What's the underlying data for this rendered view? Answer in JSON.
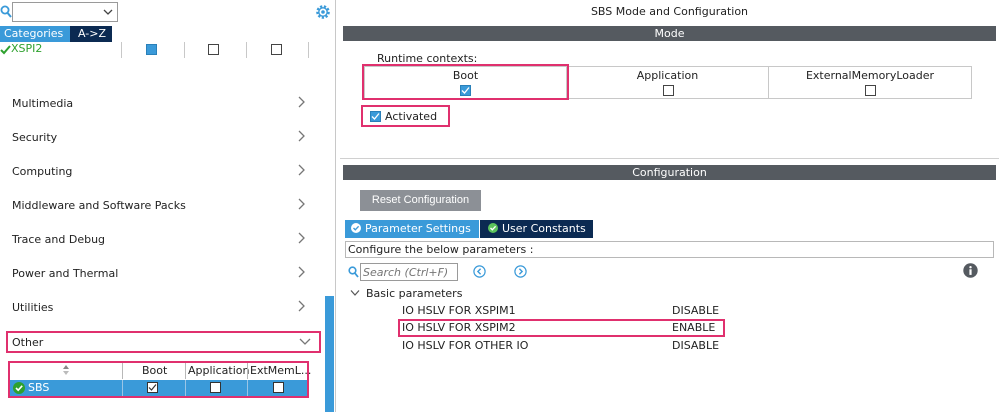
{
  "left": {
    "search": {
      "value": ""
    },
    "tabs": [
      {
        "label": "Categories"
      },
      {
        "label": "A->Z"
      }
    ],
    "xspi_row": {
      "name": "XSPI2"
    },
    "categories": [
      {
        "label": "Multimedia"
      },
      {
        "label": "Security"
      },
      {
        "label": "Computing"
      },
      {
        "label": "Middleware and Software Packs"
      },
      {
        "label": "Trace and Debug"
      },
      {
        "label": "Power and Thermal"
      },
      {
        "label": "Utilities"
      }
    ],
    "other": {
      "label": "Other"
    },
    "sbs_table": {
      "headers": [
        "Boot",
        "Application",
        "ExtMemL..."
      ],
      "row": {
        "name": "SBS",
        "boot": true,
        "application": false,
        "extmem": false
      }
    }
  },
  "right": {
    "title": "SBS Mode and Configuration",
    "mode_bar": "Mode",
    "runtime_label": "Runtime contexts:",
    "contexts": [
      {
        "label": "Boot",
        "checked": true
      },
      {
        "label": "Application",
        "checked": false
      },
      {
        "label": "ExternalMemoryLoader",
        "checked": false
      }
    ],
    "activated": {
      "label": "Activated",
      "checked": true
    },
    "config_bar": "Configuration",
    "reset_button": "Reset Configuration",
    "param_tabs": [
      {
        "label": "Parameter Settings"
      },
      {
        "label": "User Constants"
      }
    ],
    "configure_label": "Configure the below parameters :",
    "search_placeholder": "Search (Ctrl+F)",
    "basic_label": "Basic parameters",
    "params": [
      {
        "name": "IO HSLV FOR XSPIM1",
        "value": "DISABLE"
      },
      {
        "name": "IO HSLV FOR XSPIM2",
        "value": "ENABLE"
      },
      {
        "name": "IO HSLV FOR OTHER IO",
        "value": "DISABLE"
      }
    ]
  },
  "colors": {
    "accent": "#3a9ad9",
    "dark_tab": "#0b2a52",
    "highlight": "#e0306e",
    "section_bar": "#555a60",
    "ok_green": "#2ea12e"
  }
}
